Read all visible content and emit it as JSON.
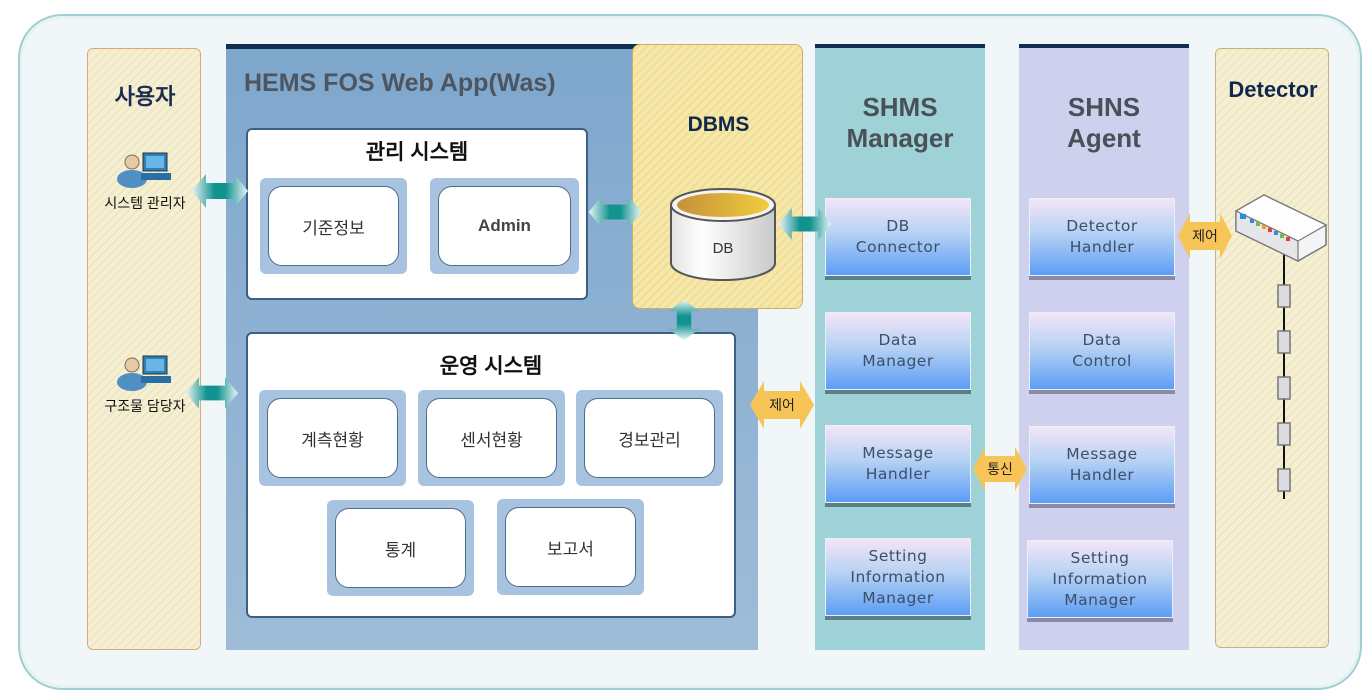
{
  "users": {
    "title": "사용자",
    "items": [
      {
        "label": "시스템 관리자",
        "icon": "user-computer-icon"
      },
      {
        "label": "구조물 담당자",
        "icon": "user-computer-icon"
      }
    ]
  },
  "webapp": {
    "title": "HEMS FOS Web App(Was)",
    "management": {
      "title": "관리 시스템",
      "modules": [
        "기준정보",
        "Admin"
      ]
    },
    "operation": {
      "title": "운영 시스템",
      "modules": [
        "계측현황",
        "센서현황",
        "경보관리",
        "통계",
        "보고서"
      ]
    }
  },
  "dbms": {
    "title": "DBMS",
    "db_label": "DB"
  },
  "shms": {
    "title_line1": "SHMS",
    "title_line2": "Manager",
    "components": [
      "DB\nConnector",
      "Data\nManager",
      "Message\nHandler",
      "Setting\nInformation\nManager"
    ]
  },
  "shns": {
    "title_line1": "SHNS",
    "title_line2": "Agent",
    "components": [
      "Detector\nHandler",
      "Data\nControl",
      "Message\nHandler",
      "Setting\nInformation\nManager"
    ]
  },
  "detector": {
    "title": "Detector",
    "sensor_count": 5
  },
  "connectors": {
    "control_label": "제어",
    "comm_label": "통신"
  },
  "colors": {
    "accent_navy": "#0f2e52",
    "webapp_blue": "#7ea7cc",
    "shms_teal": "#9ed2d6",
    "shns_lavender": "#cfd0ee",
    "arrow_teal": "#1a9a98",
    "arrow_orange": "#f7c557"
  }
}
